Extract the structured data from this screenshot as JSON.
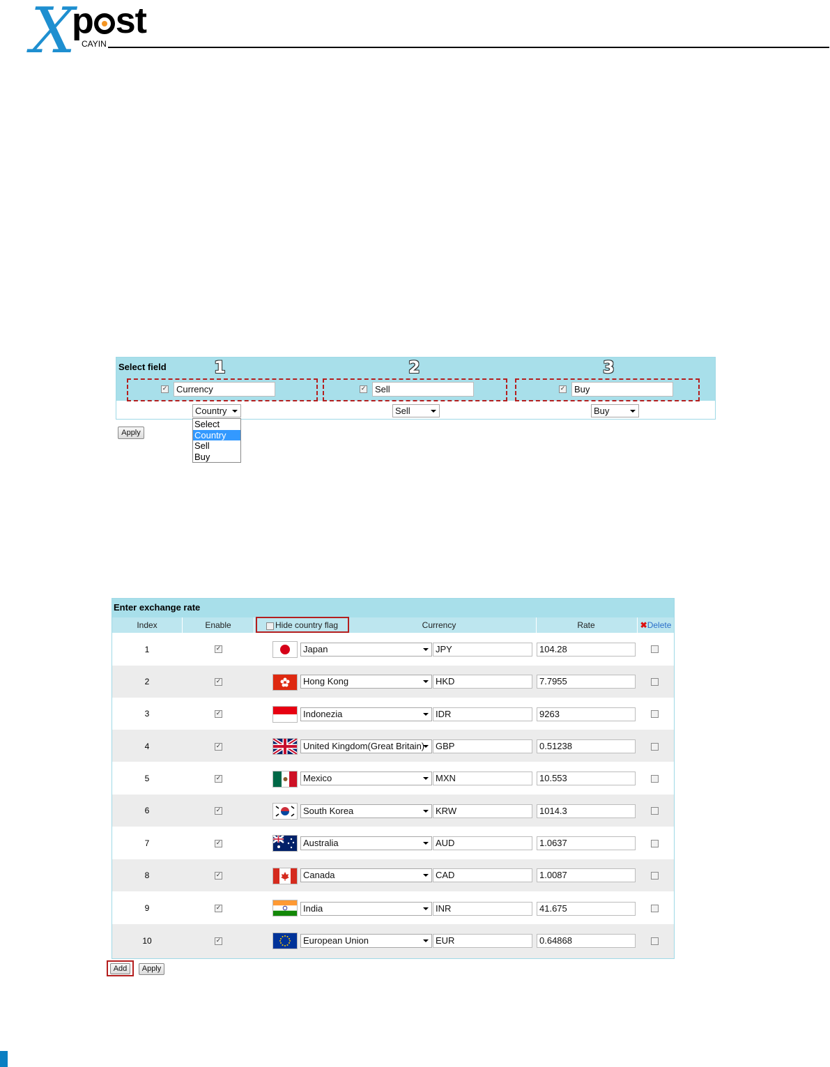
{
  "brand": {
    "logo_x": "X",
    "logo_post_p": "p",
    "logo_post_rest": "st",
    "logo_sub": "CAYIN"
  },
  "select_field": {
    "title": "Select field",
    "columns": [
      {
        "number": "1",
        "checked": true,
        "label_value": "Currency",
        "select_value": "Country"
      },
      {
        "number": "2",
        "checked": true,
        "label_value": "Sell",
        "select_value": "Sell"
      },
      {
        "number": "3",
        "checked": true,
        "label_value": "Buy",
        "select_value": "Buy"
      }
    ],
    "dropdown_options": [
      "Select",
      "Country",
      "Sell",
      "Buy"
    ],
    "dropdown_highlighted": "Country",
    "apply_label": "Apply"
  },
  "exchange_rate": {
    "title": "Enter exchange rate",
    "headers": {
      "index": "Index",
      "enable": "Enable",
      "hide_flag": "Hide country flag",
      "currency": "Currency",
      "rate": "Rate",
      "delete": "Delete"
    },
    "hide_flag_checked": false,
    "rows": [
      {
        "index": "1",
        "enabled": true,
        "flag": "japan-flag",
        "country": "Japan",
        "code": "JPY",
        "rate": "104.28",
        "delete": false
      },
      {
        "index": "2",
        "enabled": true,
        "flag": "hong-kong-flag",
        "country": "Hong Kong",
        "code": "HKD",
        "rate": "7.7955",
        "delete": false
      },
      {
        "index": "3",
        "enabled": true,
        "flag": "indonesia-flag",
        "country": "Indonezia",
        "code": "IDR",
        "rate": "9263",
        "delete": false
      },
      {
        "index": "4",
        "enabled": true,
        "flag": "uk-flag",
        "country": "United Kingdom(Great Britain)",
        "code": "GBP",
        "rate": "0.51238",
        "delete": false
      },
      {
        "index": "5",
        "enabled": true,
        "flag": "mexico-flag",
        "country": "Mexico",
        "code": "MXN",
        "rate": "10.553",
        "delete": false
      },
      {
        "index": "6",
        "enabled": true,
        "flag": "south-korea-flag",
        "country": "South Korea",
        "code": "KRW",
        "rate": "1014.3",
        "delete": false
      },
      {
        "index": "7",
        "enabled": true,
        "flag": "australia-flag",
        "country": "Australia",
        "code": "AUD",
        "rate": "1.0637",
        "delete": false
      },
      {
        "index": "8",
        "enabled": true,
        "flag": "canada-flag",
        "country": "Canada",
        "code": "CAD",
        "rate": "1.0087",
        "delete": false
      },
      {
        "index": "9",
        "enabled": true,
        "flag": "india-flag",
        "country": "India",
        "code": "INR",
        "rate": "41.675",
        "delete": false
      },
      {
        "index": "10",
        "enabled": true,
        "flag": "eu-flag",
        "country": "European Union",
        "code": "EUR",
        "rate": "0.64868",
        "delete": false
      }
    ],
    "add_label": "Add",
    "apply_label": "Apply"
  },
  "colors": {
    "brand_blue": "#1e8fd0",
    "brand_orange": "#f39422",
    "panel_header": "#a8dfea",
    "highlight_red": "#b41e1e",
    "select_highlight": "#3399ff"
  }
}
